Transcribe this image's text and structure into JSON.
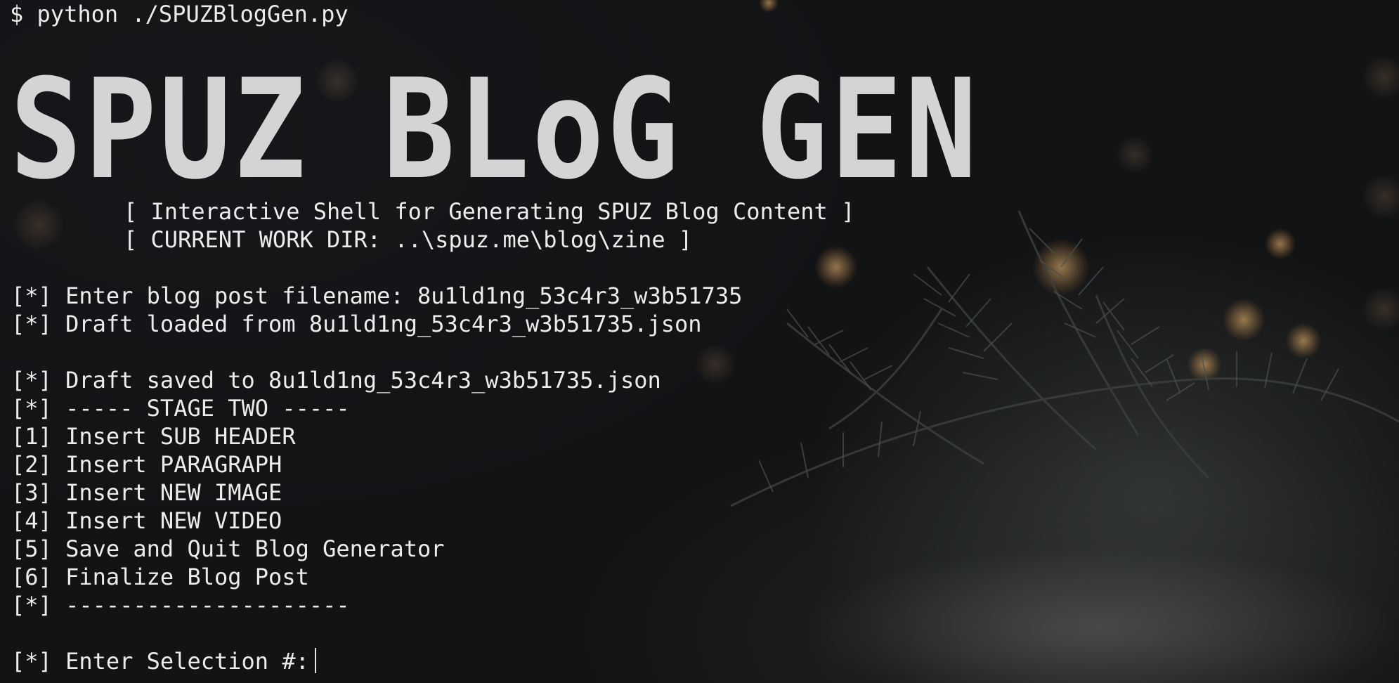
{
  "terminal": {
    "command": "$ python ./SPUZBlogGen.py",
    "logo_text": "SPUZ BLoG GEN",
    "subtitle_line1": "[ Interactive Shell for Generating SPUZ Blog Content ]",
    "subtitle_line2": "[ CURRENT WORK DIR: ..\\spuz.me\\blog\\zine ]",
    "filename_prompt": "[*] Enter blog post filename: 8u1ld1ng_53c4r3_w3b51735",
    "draft_loaded": "[*] Draft loaded from 8u1ld1ng_53c4r3_w3b51735.json",
    "draft_saved": "[*] Draft saved to 8u1ld1ng_53c4r3_w3b51735.json",
    "stage_header": "[*] ----- STAGE TWO -----",
    "menu": [
      "[1] Insert SUB HEADER",
      "[2] Insert PARAGRAPH",
      "[3] Insert NEW IMAGE",
      "[4] Insert NEW VIDEO",
      "[5] Save and Quit Blog Generator",
      "[6] Finalize Blog Post"
    ],
    "menu_footer": "[*] ---------------------",
    "selection_prompt": "[*] Enter Selection #:",
    "colors": {
      "background": "#111214",
      "text": "#ececec",
      "logo": "#d4d4d4"
    }
  }
}
